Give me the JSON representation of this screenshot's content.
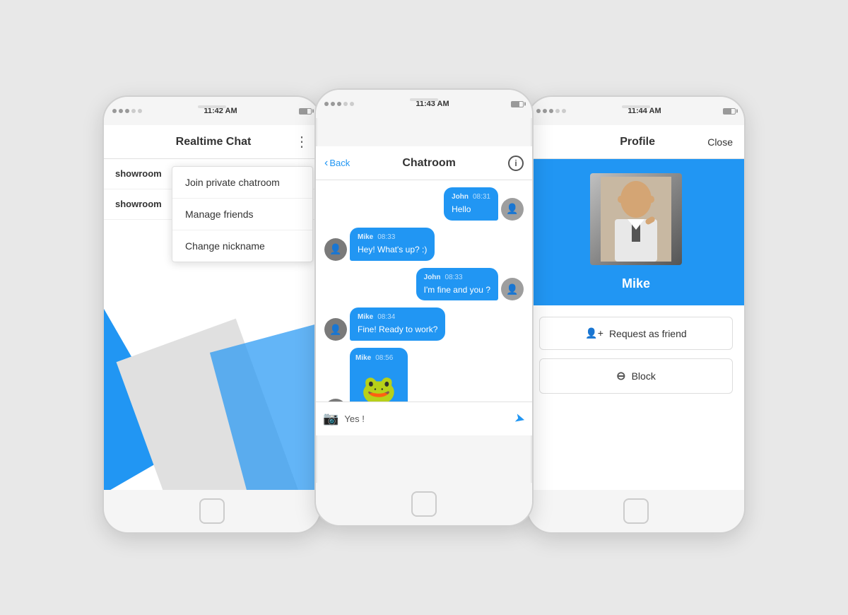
{
  "phone1": {
    "status_bar": {
      "dots": [
        true,
        true,
        true,
        false,
        false
      ],
      "time": "11:42 AM",
      "battery": "80"
    },
    "header": {
      "title": "Realtime Chat",
      "menu_icon": "⋮"
    },
    "list_items": [
      {
        "name": "showroom"
      },
      {
        "name": "showroom"
      }
    ],
    "dropdown": {
      "items": [
        "Join private chatroom",
        "Manage friends",
        "Change nickname"
      ]
    }
  },
  "phone2": {
    "status_bar": {
      "time": "11:43 AM"
    },
    "header": {
      "back_label": "Back",
      "title": "Chatroom",
      "info_icon": "i"
    },
    "messages": [
      {
        "id": "m1",
        "sender": "John",
        "time": "08:31",
        "text": "Hello",
        "side": "right",
        "avatar": "J"
      },
      {
        "id": "m2",
        "sender": "Mike",
        "time": "08:33",
        "text": "Hey! What's up? :)",
        "side": "left",
        "avatar": "M"
      },
      {
        "id": "m3",
        "sender": "John",
        "time": "08:33",
        "text": "I'm fine and you ?",
        "side": "right",
        "avatar": "J"
      },
      {
        "id": "m4",
        "sender": "Mike",
        "time": "08:34",
        "text": "Fine! Ready to work?",
        "side": "left",
        "avatar": "M"
      },
      {
        "id": "m5",
        "sender": "Mike",
        "time": "08:56",
        "text": "",
        "emoji": "🐸",
        "side": "left",
        "avatar": "M"
      }
    ],
    "input": {
      "placeholder": "Yes !",
      "camera_icon": "📷",
      "send_icon": "➤"
    }
  },
  "phone3": {
    "status_bar": {
      "time": "11:44 AM"
    },
    "header": {
      "title": "Profile",
      "close_label": "Close"
    },
    "profile": {
      "name": "Mike",
      "avatar_emoji": "👤"
    },
    "actions": [
      {
        "id": "request-friend",
        "icon": "👤",
        "label": "Request as friend"
      },
      {
        "id": "block",
        "icon": "⊖",
        "label": "Block"
      }
    ]
  }
}
